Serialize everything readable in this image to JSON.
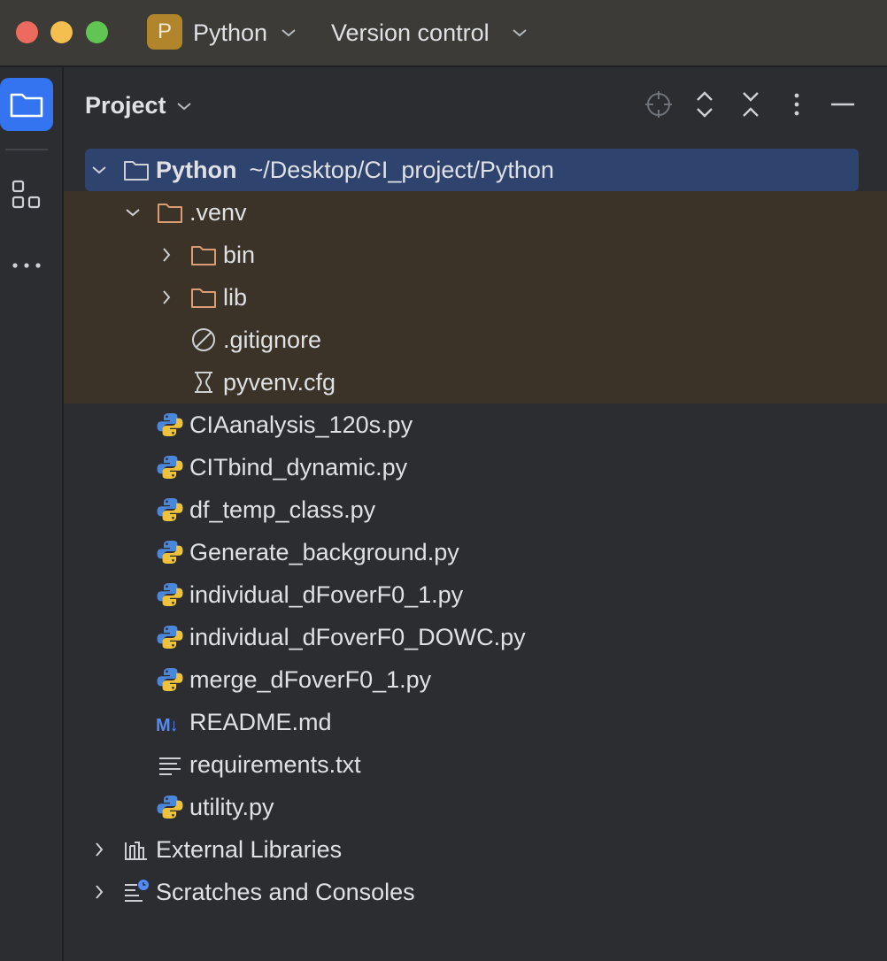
{
  "titlebar": {
    "project_badge": "P",
    "project_name": "Python",
    "vcs_label": "Version control"
  },
  "panel": {
    "title": "Project"
  },
  "tree": {
    "root": {
      "name": "Python",
      "path": "~/Desktop/CI_project/Python"
    },
    "venv": {
      "name": ".venv"
    },
    "venv_items": [
      "bin",
      "lib",
      ".gitignore",
      "pyvenv.cfg"
    ],
    "files": [
      "CIAanalysis_120s.py",
      "CITbind_dynamic.py",
      "df_temp_class.py",
      "Generate_background.py",
      "individual_dFoverF0_1.py",
      "individual_dFoverF0_DOWC.py",
      "merge_dFoverF0_1.py",
      "README.md",
      "requirements.txt",
      "utility.py"
    ],
    "readme_badge": "M↓",
    "external_libraries": "External Libraries",
    "scratches": "Scratches and Consoles"
  },
  "colors": {
    "accent": "#3574f0",
    "selection": "#2e436e",
    "excluded_bg": "#3b3327",
    "folder_excluded": "#d99c74"
  }
}
